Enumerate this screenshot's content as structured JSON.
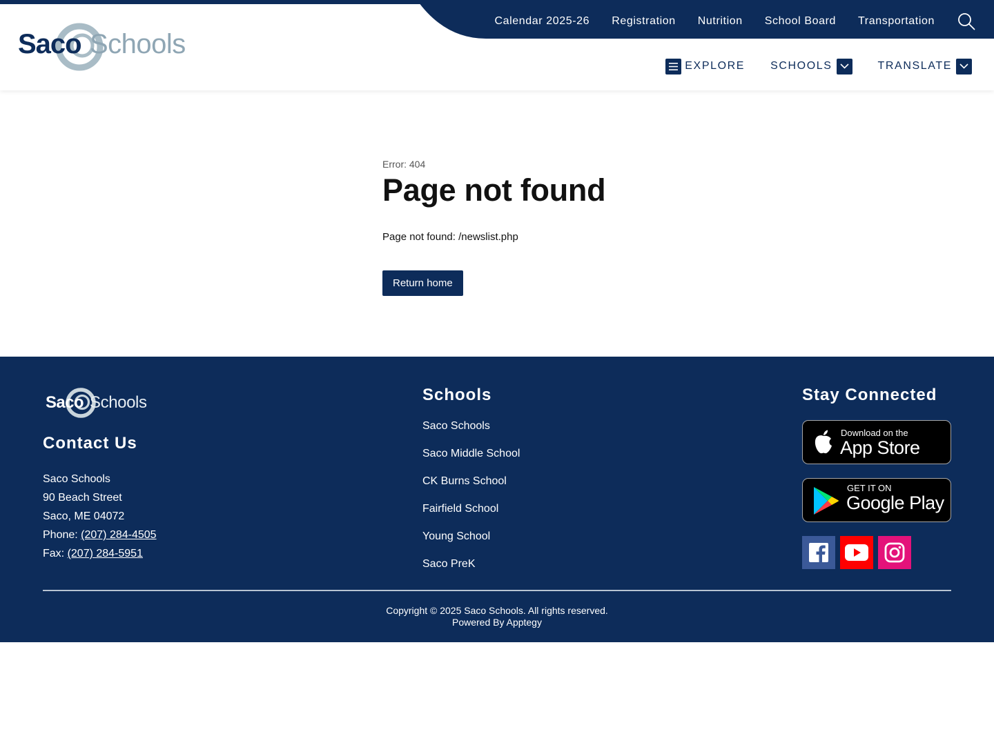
{
  "header": {
    "logo": {
      "part1": "Saco",
      "part2": "Schools"
    },
    "utility_links": [
      "Calendar 2025-26",
      "Registration",
      "Nutrition",
      "School Board",
      "Transportation"
    ],
    "main_nav": {
      "explore": "EXPLORE",
      "schools": "SCHOOLS",
      "translate": "TRANSLATE"
    }
  },
  "main": {
    "error_code": "Error: 404",
    "title": "Page not found",
    "message": "Page not found: /newslist.php",
    "return_button": "Return home"
  },
  "footer": {
    "logo": {
      "part1": "Saco",
      "part2": "Schools"
    },
    "contact": {
      "heading": "Contact Us",
      "name": "Saco Schools",
      "street": "90 Beach Street",
      "city": "Saco, ME 04072",
      "phone_label": "Phone: ",
      "phone": "(207) 284-4505",
      "fax_label": "Fax: ",
      "fax": "(207) 284-5951"
    },
    "schools": {
      "heading": "Schools",
      "items": [
        "Saco Schools",
        "Saco Middle School",
        "CK Burns School",
        "Fairfield School",
        "Young School",
        "Saco PreK"
      ]
    },
    "connect": {
      "heading": "Stay Connected",
      "app_store": {
        "small": "Download on the",
        "big": "App Store"
      },
      "google_play": {
        "small": "GET IT ON",
        "big": "Google Play"
      }
    },
    "copyright": "Copyright © 2025 Saco Schools. All rights reserved.",
    "powered_by": "Powered By Apptegy"
  },
  "colors": {
    "navy": "#0d2c5a",
    "logo_gray": "#8fa6b4",
    "facebook": "#3b5998",
    "youtube": "#ff0000",
    "instagram": "#e4127a"
  }
}
